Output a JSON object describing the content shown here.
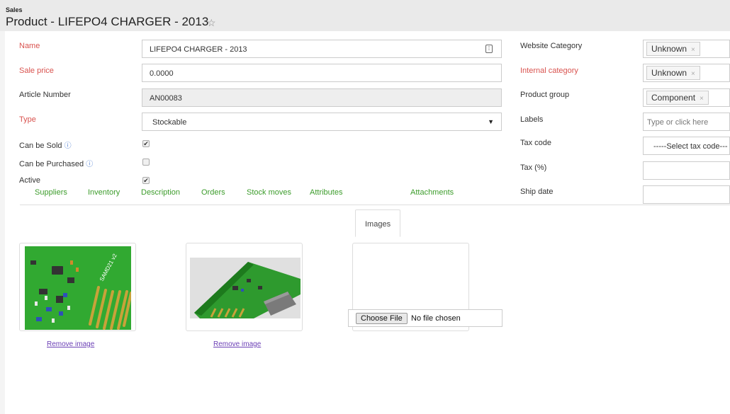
{
  "header": {
    "module": "Sales",
    "title": "Product - LIFEPO4 CHARGER - 2013"
  },
  "left": {
    "name_label": "Name",
    "name_value": "LIFEPO4 CHARGER - 2013",
    "sale_price_label": "Sale price",
    "sale_price_value": "0.0000",
    "article_label": "Article Number",
    "article_value": "AN00083",
    "type_label": "Type",
    "type_value": "Stockable",
    "can_be_sold_label": "Can be Sold",
    "can_be_sold_checked": true,
    "can_be_purchased_label": "Can be Purchased",
    "can_be_purchased_checked": false,
    "active_label": "Active",
    "active_checked": true
  },
  "right": {
    "website_category_label": "Website Category",
    "website_category_value": "Unknown",
    "internal_category_label": "Internal category",
    "internal_category_value": "Unknown",
    "product_group_label": "Product group",
    "product_group_value": "Component",
    "labels_label": "Labels",
    "labels_placeholder": "Type or click here",
    "tax_code_label": "Tax code",
    "tax_code_value": "-----Select tax code---",
    "tax_label": "Tax (%)",
    "tax_value": "",
    "ship_date_label": "Ship date",
    "ship_date_value": ""
  },
  "tabs": [
    {
      "label": "Suppliers",
      "active": false
    },
    {
      "label": "Inventory",
      "active": false
    },
    {
      "label": "Description",
      "active": false
    },
    {
      "label": "Orders",
      "active": false
    },
    {
      "label": "Stock moves",
      "active": false
    },
    {
      "label": "Attributes",
      "active": false
    },
    {
      "label": "Images",
      "active": true
    },
    {
      "label": "Attachments",
      "active": false
    }
  ],
  "images": {
    "remove_label": "Remove image",
    "choose_file_label": "Choose File",
    "no_file_label": "No file chosen"
  },
  "icons": {
    "star": "star-icon",
    "edit": "field-edit-icon",
    "dropdown": "dropdown-caret-icon",
    "help": "help-circle-icon",
    "tag_remove": "close-icon"
  },
  "colors": {
    "required_label": "#d9534f",
    "tab_link": "#3c9c2b",
    "remove_link": "#6b3fb5",
    "pcb_green": "#2fa02f"
  }
}
